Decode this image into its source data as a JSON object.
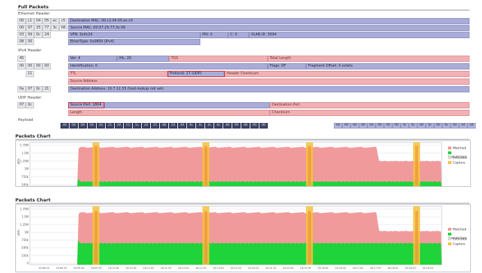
{
  "page": {
    "title": "Full Packets"
  },
  "ethernet": {
    "title": "Ethernet Header",
    "rows": [
      {
        "bytes": [
          "00",
          "c1",
          "04",
          "05",
          "ec",
          "c5"
        ],
        "field": "Destination MAC: 00:c1:04:05:ec:c5"
      },
      {
        "bytes": [
          "00",
          "07",
          "25",
          "77",
          "3c",
          "06"
        ],
        "field": "Source MAC: 00:07:25:77:3c:06"
      },
      {
        "bytes": [
          "03",
          "09",
          "0c",
          "24"
        ],
        "field": "VPN: 0x0c24",
        "extra": [
          "PRI: 0",
          "C: 0",
          "VLAN ID: 3094"
        ]
      },
      {
        "bytes": [
          "08",
          "00"
        ],
        "field": "EtherType: 0x0800 (IPv4)"
      }
    ]
  },
  "ipv4": {
    "title": "IPv4 Header",
    "rows": [
      {
        "bytes": [
          "45"
        ],
        "cells": [
          "Ver: 4",
          "IHL: 20",
          "TOS",
          "Total Length"
        ]
      },
      {
        "bytes": [
          "00",
          "00",
          "00",
          "00"
        ],
        "cells": [
          "Identification: 0",
          "Flags: DF",
          "Fragment Offset: 0 octets"
        ]
      },
      {
        "bytes": [
          "11"
        ],
        "cells": [
          "TTL",
          "Protocol: 17 (UDP)",
          "Header Checksum"
        ]
      },
      {
        "bytes": [],
        "cells": [
          "Source Address"
        ]
      },
      {
        "bytes": [
          "0a",
          "07",
          "0c",
          "21"
        ],
        "cells": [
          "Destination Address: 10.7.12.33 (host-lookup not set)"
        ]
      }
    ]
  },
  "udp": {
    "title": "UDP Header",
    "rows": [
      {
        "bytes": [
          "07",
          "0c"
        ],
        "cells": [
          "Source Port: 1804",
          "Destination Port"
        ]
      },
      {
        "bytes": [],
        "cells": [
          "Length",
          "Checksum"
        ]
      }
    ]
  },
  "payload": {
    "title": "Payload",
    "bytes": [
      "40",
      "04",
      "04",
      "04",
      "24",
      "21",
      "24",
      "11",
      "1c",
      "24",
      "21",
      "48",
      "24",
      "44",
      "9c",
      "4c",
      "4c",
      "4c",
      "46",
      "09",
      "48",
      "00",
      "00",
      "04",
      "00",
      "00",
      "00",
      "04",
      "00",
      "00",
      "00",
      "0c",
      "0c",
      "00",
      "0c",
      "00",
      "0c",
      "00",
      "04",
      "04"
    ]
  },
  "charts": [
    {
      "title": "Packets Chart",
      "legend": [
        "Matched",
        "Unmatched",
        "Excluded",
        "Capture"
      ],
      "colors": {
        "matched": "#f19a9c",
        "unmatched": "#1fd43a",
        "excluded": "#d8d8d8",
        "capture": "#f5c23a"
      },
      "yTicks": [
        "1.75M",
        "1.5M",
        "1.25M",
        "1M",
        "750k",
        "500k"
      ],
      "yLabel": "pkts"
    },
    {
      "title": "Packets Chart",
      "legend": [
        "Matched",
        "Unmatched",
        "Excluded",
        "Capture"
      ],
      "colors": {
        "matched": "#f19a9c",
        "unmatched": "#1fd43a",
        "excluded": "#d8d8d8",
        "capture": "#f5c23a"
      },
      "yTicks": [
        "1.75M",
        "1.5M",
        "1.25M",
        "1M",
        "750k",
        "500k",
        "250k",
        "0"
      ],
      "yLabel": "pkts",
      "xTicks": [
        "16:08:00",
        "16:08:30",
        "16:09:00",
        "16:09:30",
        "16:10:00",
        "16:10:30",
        "16:11:00",
        "16:11:30",
        "16:12:00",
        "16:12:30",
        "16:13:00",
        "16:13:30",
        "16:14:00",
        "16:14:30",
        "16:15:00",
        "16:15:30",
        "16:16:00",
        "16:16:30",
        "16:17:00",
        "16:17:30",
        "16:18:00",
        "16:18:30",
        "16:19:00"
      ]
    }
  ]
}
